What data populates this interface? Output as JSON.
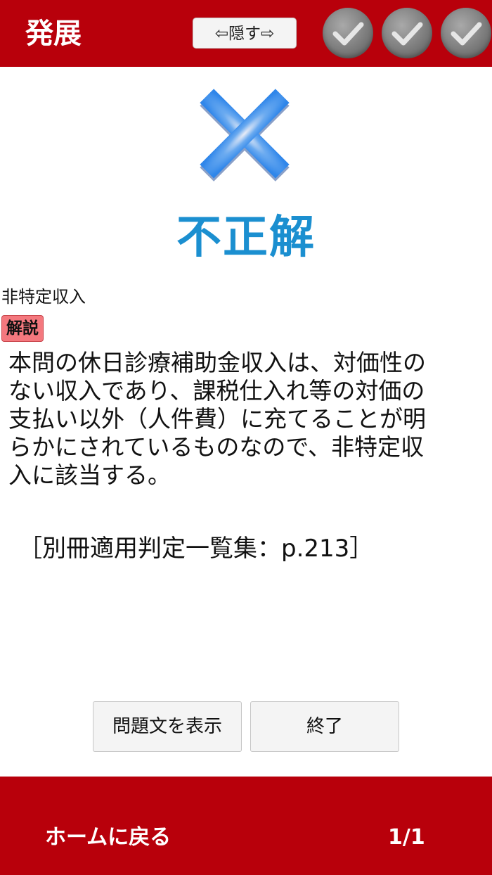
{
  "header": {
    "title": "発展",
    "hide_label": "⇦隠す⇨",
    "progress_checks": [
      "check-icon",
      "check-icon",
      "check-icon"
    ]
  },
  "result": {
    "icon": "cross-mark-icon",
    "label": "不正解",
    "color": "#1b8fd0"
  },
  "answer": {
    "category": "非特定収入",
    "badge": "解説",
    "explanation": "本問の休日診療補助金収入は、対価性の\nない収入であり、課税仕入れ等の対価の\n支払い以外（人件費）に充てることが明\nらかにされているものなので、非特定収\n入に該当する。",
    "reference": "［別冊適用判定一覧集：p.213］"
  },
  "actions": {
    "show_question_label": "問題文を表示",
    "finish_label": "終了"
  },
  "footer": {
    "home_label": "ホームに戻る",
    "pager": "1/1"
  },
  "colors": {
    "brand": "#b8000b",
    "badge": "#f4787e",
    "accent": "#1b8fd0"
  }
}
